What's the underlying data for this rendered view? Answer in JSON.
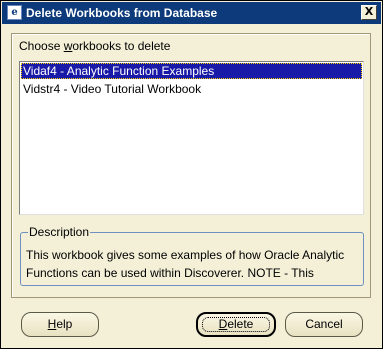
{
  "window": {
    "title": "Delete Workbooks from Database",
    "icon": "app-icon",
    "close_label": "X"
  },
  "workbooks": {
    "label_prefix": "Choose ",
    "label_hotkey": "w",
    "label_suffix": "orkbooks to delete",
    "items": [
      {
        "label": "Vidaf4 - Analytic Function Examples",
        "selected": true
      },
      {
        "label": "Vidstr4 - Video Tutorial Workbook",
        "selected": false
      }
    ]
  },
  "description": {
    "legend": "Description",
    "line1": "This workbook gives some examples of how Oracle Analytic",
    "line2": "Functions can be used within Discoverer. NOTE - This"
  },
  "buttons": {
    "help": {
      "hotkey": "H",
      "rest": "elp"
    },
    "delete": {
      "hotkey": "D",
      "rest": "elete"
    },
    "cancel": {
      "label": "Cancel"
    }
  },
  "colors": {
    "titlebar": "#0c3a7a",
    "selection": "#1a1aa8",
    "dialog_bg": "#f4f0d8"
  }
}
